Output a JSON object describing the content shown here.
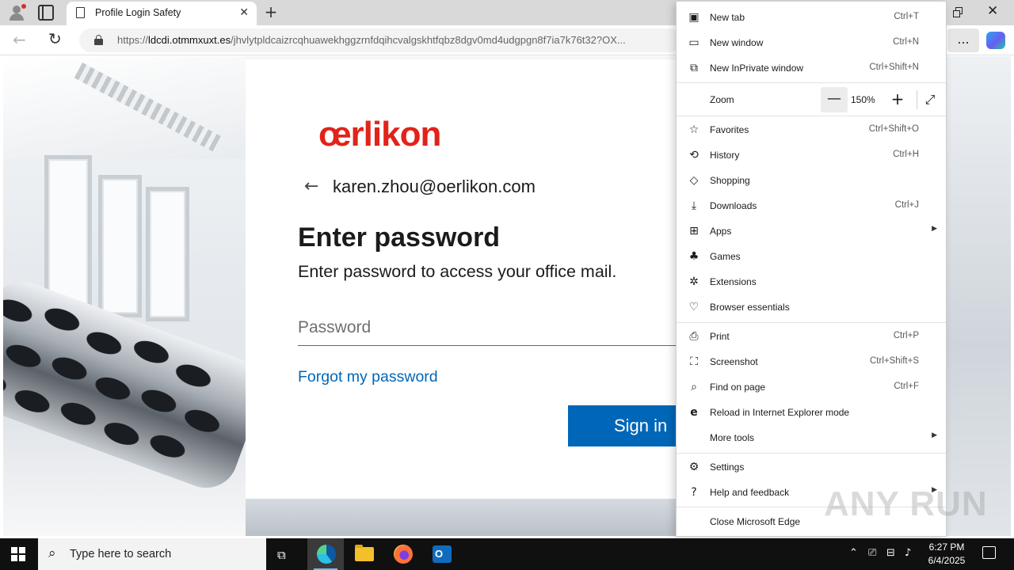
{
  "browser": {
    "tab_title": "Profile Login Safety",
    "url_host": "ldcdi.otmmxuxt.es",
    "url_rest": "/jhvlytpldcaizrcqhuawekhggzrnfdqihcvalgskhtfqbz8dgv0md4udgpgn8f7ia7k76t32?OX...",
    "more_button_label": "...",
    "icons": [
      "profile-icon",
      "tab-actions-icon",
      "page-icon",
      "close-icon",
      "new-tab-icon",
      "restore-icon",
      "back-icon",
      "refresh-icon",
      "lock-icon",
      "copilot-icon"
    ]
  },
  "page": {
    "logo_text": "œrlikon",
    "logo_color": "#e2231a",
    "email": "karen.zhou@oerlikon.com",
    "heading": "Enter password",
    "subheading": "Enter password to access your office mail.",
    "password_placeholder": "Password",
    "password_value": "",
    "forgot_link": "Forgot my password",
    "signin_label": "Sign in",
    "accent_color": "#0067b8"
  },
  "menu": {
    "items": [
      {
        "label": "New tab",
        "shortcut": "Ctrl+T",
        "icon": "new-tab-icon"
      },
      {
        "label": "New window",
        "shortcut": "Ctrl+N",
        "icon": "new-window-icon"
      },
      {
        "label": "New InPrivate window",
        "shortcut": "Ctrl+Shift+N",
        "icon": "inprivate-icon"
      },
      {
        "label": "Favorites",
        "shortcut": "Ctrl+Shift+O",
        "icon": "star-icon"
      },
      {
        "label": "History",
        "shortcut": "Ctrl+H",
        "icon": "history-icon"
      },
      {
        "label": "Shopping",
        "shortcut": "",
        "icon": "tag-icon"
      },
      {
        "label": "Downloads",
        "shortcut": "Ctrl+J",
        "icon": "download-icon"
      },
      {
        "label": "Apps",
        "shortcut": "",
        "icon": "apps-icon"
      },
      {
        "label": "Games",
        "shortcut": "",
        "icon": "games-icon"
      },
      {
        "label": "Extensions",
        "shortcut": "",
        "icon": "puzzle-icon"
      },
      {
        "label": "Browser essentials",
        "shortcut": "",
        "icon": "heart-pulse-icon"
      },
      {
        "label": "Print",
        "shortcut": "Ctrl+P",
        "icon": "printer-icon"
      },
      {
        "label": "Screenshot",
        "shortcut": "Ctrl+Shift+S",
        "icon": "screenshot-icon"
      },
      {
        "label": "Find on page",
        "shortcut": "Ctrl+F",
        "icon": "find-icon"
      },
      {
        "label": "Reload in Internet Explorer mode",
        "shortcut": "",
        "icon": "ie-icon"
      },
      {
        "label": "More tools",
        "shortcut": "",
        "icon": ""
      },
      {
        "label": "Settings",
        "shortcut": "",
        "icon": "gear-icon"
      },
      {
        "label": "Help and feedback",
        "shortcut": "",
        "icon": "help-icon"
      },
      {
        "label": "Close Microsoft Edge",
        "shortcut": "",
        "icon": ""
      }
    ],
    "zoom_label": "Zoom",
    "zoom_value": "150%",
    "zoom_minus": "—",
    "zoom_plus": "+"
  },
  "taskbar": {
    "search_placeholder": "Type here to search",
    "time": "6:27 PM",
    "date": "6/4/2025",
    "apps": [
      "edge-icon",
      "file-explorer-icon",
      "firefox-icon",
      "outlook-icon"
    ]
  },
  "watermark": "ANY RUN"
}
